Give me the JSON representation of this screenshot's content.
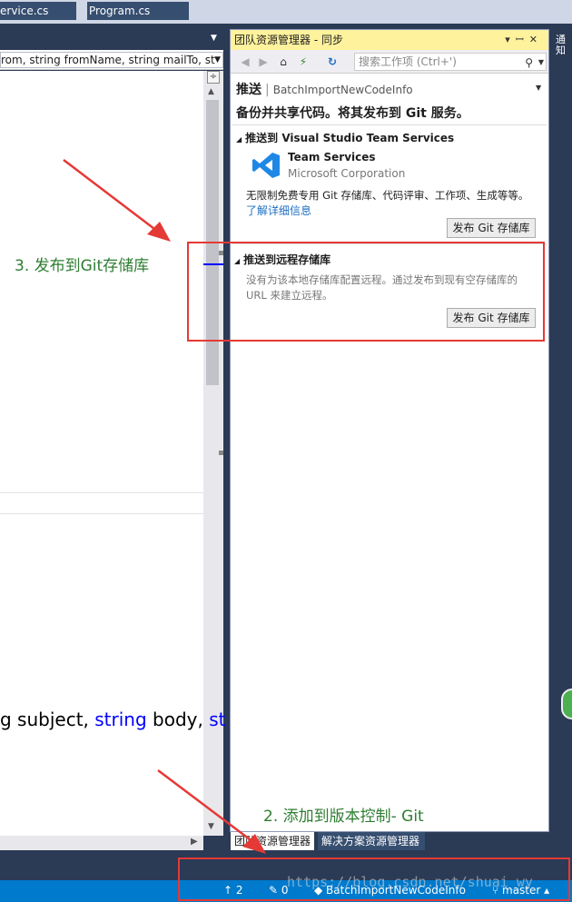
{
  "editor": {
    "tabs": [
      {
        "label": "ervice.cs"
      },
      {
        "label": "Program.cs"
      }
    ],
    "nav_combo": "rom, string fromName, string mailTo, st",
    "code_line": {
      "part1": "g subject, ",
      "kw1": "string",
      "part2": " body, ",
      "kw2": "st"
    }
  },
  "annotations": {
    "step3": "3. 发布到Git存储库",
    "step2": "2. 添加到版本控制- Git"
  },
  "team_explorer": {
    "title": "团队资源管理器 - 同步",
    "search_placeholder": "搜索工作项 (Ctrl+')",
    "push_title": "推送",
    "push_branch": "BatchImportNewCodeInfo",
    "push_subtitle": "备份并共享代码。将其发布到 Git 服务。",
    "vsts": {
      "header": "推送到 Visual Studio Team Services",
      "product_name": "Team Services",
      "corp": "Microsoft Corporation",
      "description": "无限制免费专用 Git 存储库、代码评审、工作项、生成等等。",
      "learn_more": "了解详细信息",
      "publish_button": "发布 Git 存储库"
    },
    "remote": {
      "header": "推送到远程存储库",
      "desc_line1": "没有为该本地存储库配置远程。通过发布到现有空存储库的",
      "desc_line2": "URL 来建立远程。",
      "publish_button": "发布 Git 存储库"
    },
    "bottom_tabs": [
      {
        "label": "团队资源管理器"
      },
      {
        "label": "解决方案资源管理器"
      }
    ]
  },
  "right_strip": {
    "label": "通知"
  },
  "statusbar": {
    "up_count": "2",
    "pencil_count": "0",
    "repo": "BatchImportNewCodeInfo",
    "branch": "master"
  },
  "watermark": "https://blog.csdn.net/shuai_wy",
  "colors": {
    "accent_blue": "#007acc",
    "title_yellow": "#fff29d",
    "annotation_green": "#2e7d32",
    "highlight_red": "#e53935"
  }
}
